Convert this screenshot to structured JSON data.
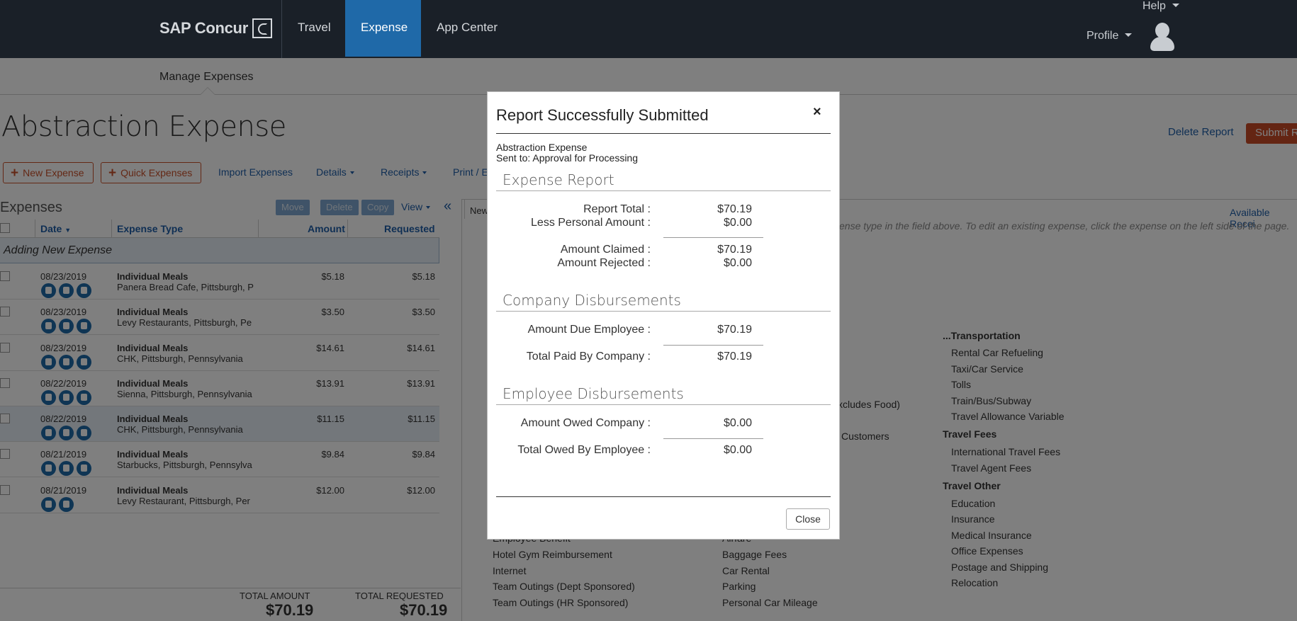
{
  "nav": {
    "logo": "SAP Concur",
    "tabs": [
      {
        "label": "Travel"
      },
      {
        "label": "Expense"
      },
      {
        "label": "App Center"
      }
    ],
    "help": "Help",
    "profile": "Profile"
  },
  "subnav": {
    "label": "Manage Expenses"
  },
  "report": {
    "title": "Abstraction Expense",
    "delete_label": "Delete Report",
    "submit_label": "Submit Re"
  },
  "toolbar": {
    "new_expense": "New Expense",
    "quick_expenses": "Quick Expenses",
    "import_expenses": "Import Expenses",
    "details": "Details",
    "receipts": "Receipts",
    "print": "Print / E"
  },
  "expenses": {
    "title": "Expenses",
    "move": "Move",
    "delete": "Delete",
    "copy": "Copy",
    "view": "View",
    "collapse": "«",
    "headers": {
      "date": "Date",
      "type": "Expense Type",
      "amount": "Amount",
      "requested": "Requested"
    },
    "adding": "Adding New Expense",
    "rows": [
      {
        "date": "08/23/2019",
        "type": "Individual Meals",
        "merchant": "Panera Bread Cafe, Pittsburgh, P",
        "amount": "$5.18",
        "requested": "$5.18"
      },
      {
        "date": "08/23/2019",
        "type": "Individual Meals",
        "merchant": "Levy Restaurants, Pittsburgh, Pe",
        "amount": "$3.50",
        "requested": "$3.50"
      },
      {
        "date": "08/23/2019",
        "type": "Individual Meals",
        "merchant": "CHK, Pittsburgh, Pennsylvania",
        "amount": "$14.61",
        "requested": "$14.61"
      },
      {
        "date": "08/22/2019",
        "type": "Individual Meals",
        "merchant": "Sienna, Pittsburgh, Pennsylvania",
        "amount": "$13.91",
        "requested": "$13.91"
      },
      {
        "date": "08/22/2019",
        "type": "Individual Meals",
        "merchant": "CHK, Pittsburgh, Pennsylvania",
        "amount": "$11.15",
        "requested": "$11.15"
      },
      {
        "date": "08/21/2019",
        "type": "Individual Meals",
        "merchant": "Starbucks, Pittsburgh, Pennsylva",
        "amount": "$9.84",
        "requested": "$9.84"
      },
      {
        "date": "08/21/2019",
        "type": "Individual Meals",
        "merchant": "Levy Restaurant, Pittsburgh, Per",
        "amount": "$12.00",
        "requested": "$12.00"
      }
    ],
    "total_amount_label": "TOTAL AMOUNT",
    "total_amount": "$70.19",
    "total_requested_label": "TOTAL REQUESTED",
    "total_requested": "$70.19"
  },
  "rightpane": {
    "tab": "New",
    "available_receipts": "Available Recei",
    "hint": "ense type in the field above. To edit an existing expense, click the expense on the left side of the page.",
    "col2_partial": [
      "xcludes Food)",
      "Customers"
    ],
    "col1": [
      "Employee Benefit",
      "Hotel Gym Reimbursement",
      "Internet",
      "Team Outings (Dept Sponsored)",
      "Team Outings (HR Sponsored)"
    ],
    "col2": [
      "Airfare",
      "Baggage Fees",
      "Car Rental",
      "Parking",
      "Personal Car Mileage"
    ],
    "col3": {
      "transportation_head": "...Transportation",
      "transportation": [
        "Rental Car Refueling",
        "Taxi/Car Service",
        "Tolls",
        "Train/Bus/Subway",
        "Travel Allowance Variable"
      ],
      "fees_head": "Travel Fees",
      "fees": [
        "International Travel Fees",
        "Travel Agent Fees"
      ],
      "other_head": "Travel Other",
      "other": [
        "Education",
        "Insurance",
        "Medical Insurance",
        "Office Expenses",
        "Postage and Shipping",
        "Relocation"
      ]
    }
  },
  "modal": {
    "title": "Report Successfully Submitted",
    "close_x": "×",
    "report_name": "Abstraction Expense",
    "sent_to": "Sent to: Approval for Processing",
    "section1": "Expense Report",
    "report_total_label": "Report Total :",
    "report_total": "$70.19",
    "less_personal_label": "Less Personal Amount :",
    "less_personal": "$0.00",
    "amount_claimed_label": "Amount Claimed :",
    "amount_claimed": "$70.19",
    "amount_rejected_label": "Amount Rejected :",
    "amount_rejected": "$0.00",
    "section2": "Company Disbursements",
    "due_employee_label": "Amount Due Employee :",
    "due_employee": "$70.19",
    "paid_company_label": "Total Paid By Company :",
    "paid_company": "$70.19",
    "section3": "Employee Disbursements",
    "owed_company_label": "Amount Owed Company :",
    "owed_company": "$0.00",
    "owed_employee_label": "Total Owed By Employee :",
    "owed_employee": "$0.00",
    "close_button": "Close"
  }
}
